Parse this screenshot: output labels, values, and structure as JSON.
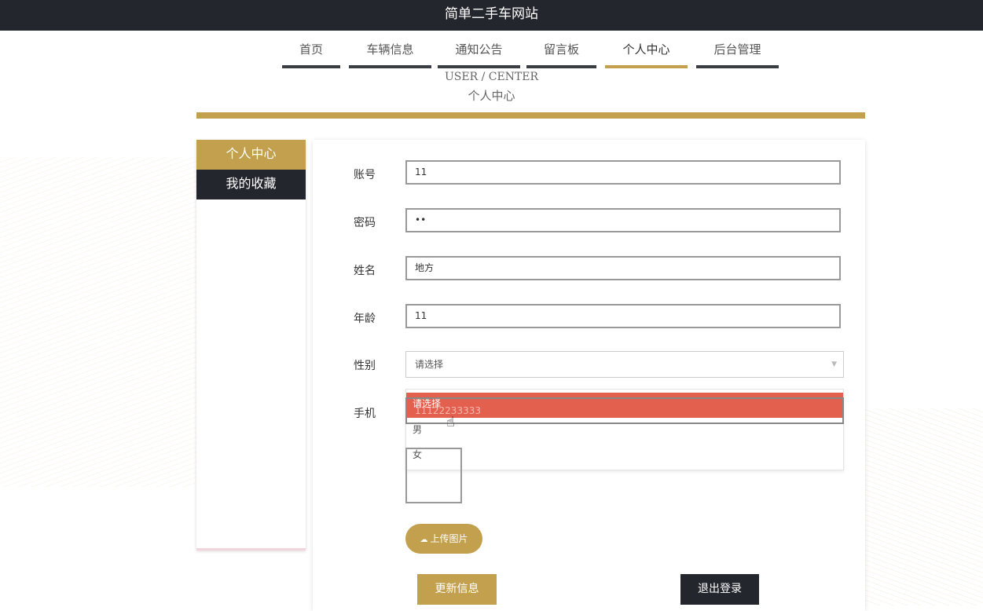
{
  "site": {
    "title": "简单二手车网站"
  },
  "nav": [
    {
      "label": "首页"
    },
    {
      "label": "车辆信息"
    },
    {
      "label": "通知公告"
    },
    {
      "label": "留言板"
    },
    {
      "label": "个人中心"
    },
    {
      "label": "后台管理"
    }
  ],
  "heading": {
    "en": "USER / CENTER",
    "cn": "个人中心"
  },
  "sidebar": {
    "items": [
      {
        "label": "个人中心"
      },
      {
        "label": "我的收藏"
      }
    ]
  },
  "form": {
    "account": {
      "label": "账号",
      "value": "11"
    },
    "password": {
      "label": "密码",
      "value": "••"
    },
    "name": {
      "label": "姓名",
      "value": "地方"
    },
    "age": {
      "label": "年龄",
      "value": "11"
    },
    "gender": {
      "label": "性别",
      "value": "请选择",
      "options": [
        "请选择",
        "男",
        "女"
      ]
    },
    "phone": {
      "label": "手机",
      "value": "11122233333"
    },
    "upload_label": "上传图片",
    "update_label": "更新信息",
    "logout_label": "退出登录"
  },
  "colors": {
    "accent": "#c2a04e",
    "dark": "#23262d",
    "highlight": "#e4604e"
  },
  "icons": {
    "upload": "cloud-upload-icon",
    "cursor": "hand-pointer-icon",
    "arrow": "chevron-down-icon"
  }
}
